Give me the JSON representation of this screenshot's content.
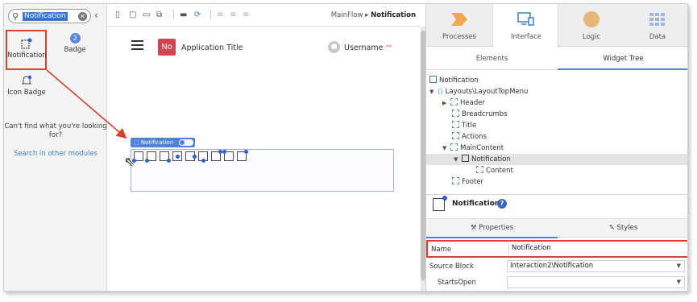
{
  "toolbox": {
    "search_value": "Notification",
    "items": [
      {
        "label": "Notification",
        "icon": "notification-icon"
      },
      {
        "label": "Badge",
        "badge": "2",
        "icon": "badge-icon"
      },
      {
        "label": "Icon Badge",
        "icon": "icon-badge-icon"
      }
    ],
    "cant_find": "Can't find what you're looking for?",
    "search_other": "Search in other modules"
  },
  "toolbar": {
    "breadcrumb_parent": "MainFlow",
    "breadcrumb_current": "Notification"
  },
  "canvas": {
    "logo_text": "No",
    "app_title": "Application Title",
    "username": "Username",
    "widget_label": "Notification"
  },
  "right_panel": {
    "tabs": [
      {
        "label": "Processes",
        "icon": "processes-icon"
      },
      {
        "label": "Interface",
        "icon": "interface-icon"
      },
      {
        "label": "Logic",
        "icon": "logic-icon"
      },
      {
        "label": "Data",
        "icon": "data-icon"
      }
    ],
    "subtabs": [
      "Elements",
      "Widget Tree"
    ],
    "tree": [
      {
        "label": "Notification",
        "indent": 0,
        "caret": "",
        "kind": "page"
      },
      {
        "label": "Layouts\\LayoutTopMenu",
        "indent": 0,
        "caret": "▼",
        "kind": "layout"
      },
      {
        "label": "Header",
        "indent": 1,
        "caret": "▶",
        "kind": "box"
      },
      {
        "label": "Breadcrumbs",
        "indent": 2,
        "caret": "",
        "kind": "box"
      },
      {
        "label": "Title",
        "indent": 2,
        "caret": "",
        "kind": "box"
      },
      {
        "label": "Actions",
        "indent": 2,
        "caret": "",
        "kind": "box"
      },
      {
        "label": "MainContent",
        "indent": 1,
        "caret": "▼",
        "kind": "box"
      },
      {
        "label": "Notification",
        "indent": 2,
        "caret": "▼",
        "kind": "notif"
      },
      {
        "label": "Content",
        "indent": 3,
        "caret": "",
        "kind": "box"
      },
      {
        "label": "Footer",
        "indent": 2,
        "caret": "",
        "kind": "box"
      }
    ],
    "selected_widget": "Notification",
    "prop_tabs": [
      "Properties",
      "Styles"
    ],
    "properties": [
      {
        "label": "Name",
        "value": "Notification"
      },
      {
        "label": "Source Block",
        "value": "Interaction2\\Notification"
      },
      {
        "label": "StartsOpen",
        "value": ""
      }
    ]
  },
  "colors": {
    "highlight_red": "#d9412a",
    "accent_blue": "#4f82dd",
    "logo_red": "#d2454f"
  }
}
